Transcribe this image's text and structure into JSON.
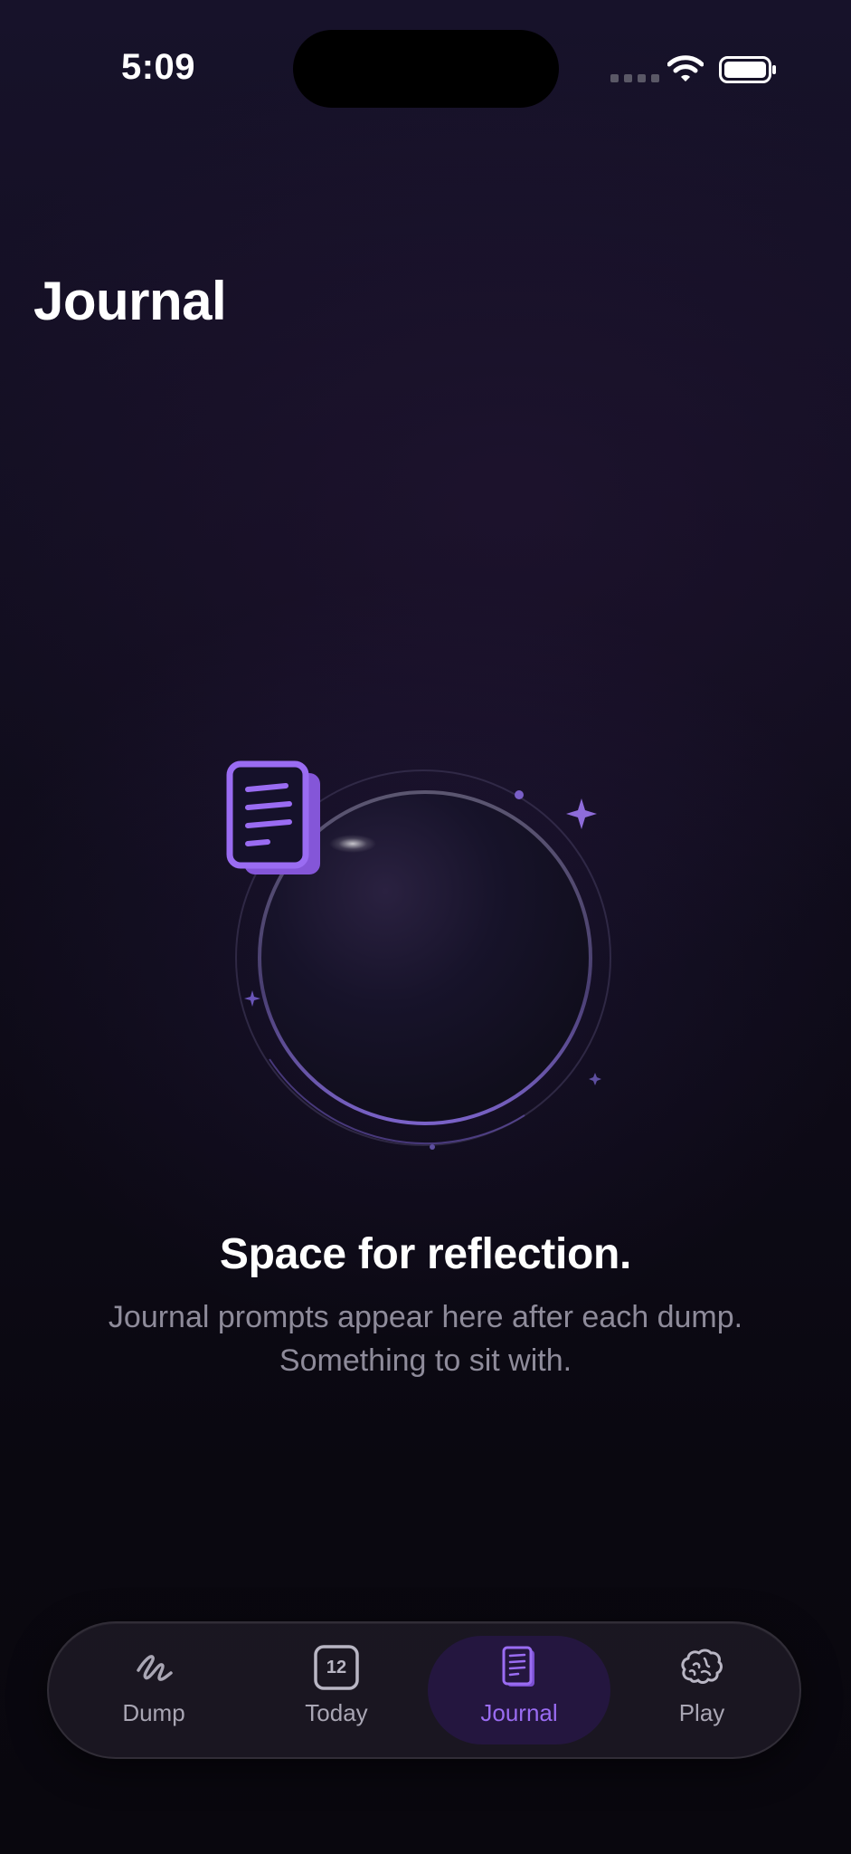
{
  "status_bar": {
    "time": "5:09",
    "icons": [
      "cellular-dots-icon",
      "wifi-icon",
      "battery-icon"
    ]
  },
  "page": {
    "title": "Journal"
  },
  "empty_state": {
    "icon": "journal-pages-icon",
    "title": "Space for reflection.",
    "line_1": "Journal prompts appear here after each dump.",
    "line_2": "Something to sit with."
  },
  "tab_bar": {
    "active_tab": "Journal",
    "tabs": [
      {
        "label": "Dump",
        "icon": "scribble-icon"
      },
      {
        "label": "Today",
        "icon": "calendar-icon",
        "icon_text": "12"
      },
      {
        "label": "Journal",
        "icon": "journal-icon"
      },
      {
        "label": "Play",
        "icon": "brain-icon"
      }
    ]
  },
  "colors": {
    "accent": "#9a6cf2",
    "background": "#0a0810",
    "tab_active_background": "#24163f",
    "secondary_text": "#8e8b9a",
    "tab_inactive_text": "#a9a6b4"
  }
}
